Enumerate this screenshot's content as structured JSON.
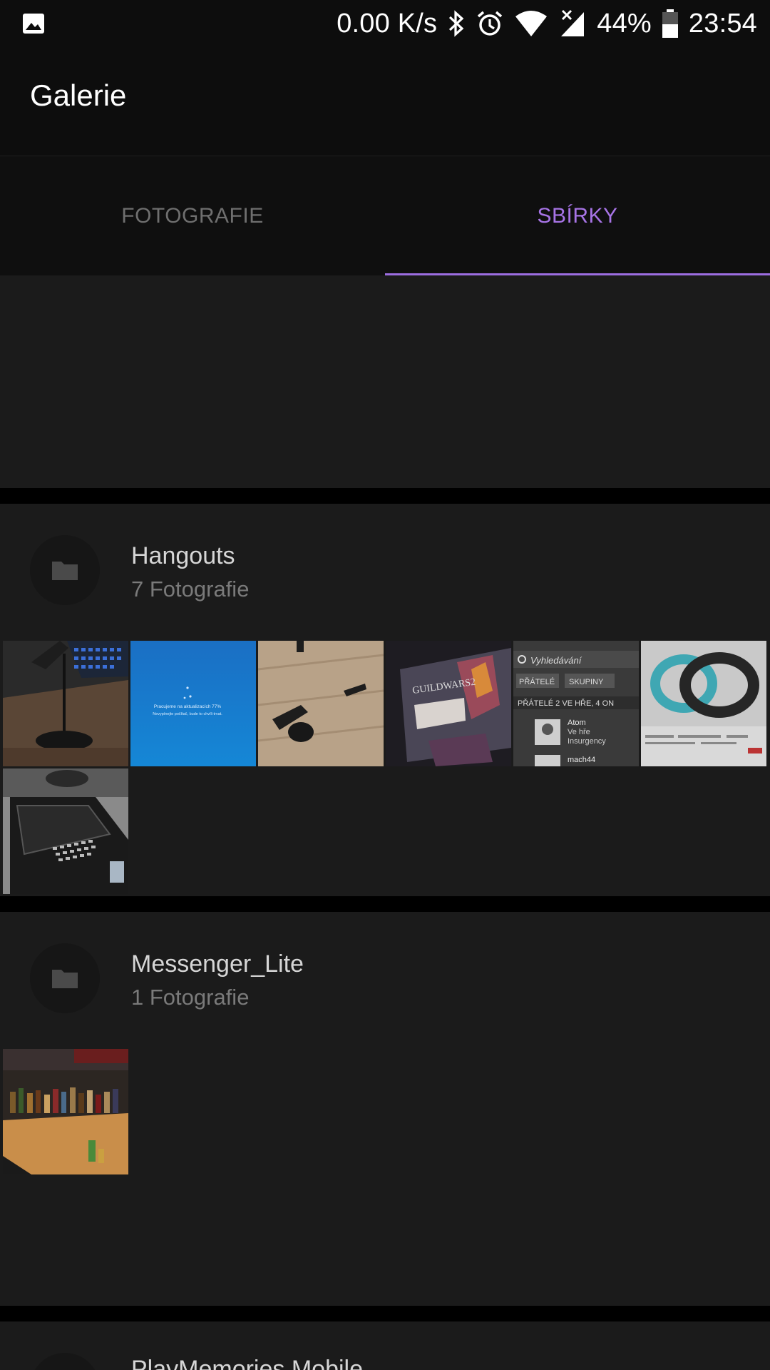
{
  "status_bar": {
    "net_speed": "0.00 K/s",
    "battery": "44%",
    "time": "23:54",
    "icons": [
      "gallery-notification-icon",
      "bluetooth-icon",
      "alarm-icon",
      "wifi-icon",
      "signal-icon",
      "battery-icon"
    ]
  },
  "app_bar": {
    "title": "Galerie"
  },
  "tabs": [
    {
      "label": "FOTOGRAFIE",
      "selected": false
    },
    {
      "label": "SBÍRKY",
      "selected": true
    }
  ],
  "colors": {
    "accent": "#a774e6",
    "background": "#1b1b1b",
    "separator": "#000000"
  },
  "albums": [
    {
      "name": "Hangouts",
      "count": "7 Fotografie",
      "icon": "folder-icon",
      "thumbnails": [
        "desk-lamp-photo",
        "windows-update-screen-photo",
        "chair-base-photo",
        "guild-wars-2-photo",
        "steam-friends-list-photo",
        "fitness-band-photo",
        "blackberry-phone-photo"
      ]
    },
    {
      "name": "Messenger_Lite",
      "count": "1 Fotografie",
      "icon": "folder-icon",
      "thumbnails": [
        "bottle-shelf-photo"
      ]
    },
    {
      "name": "PlayMemories Mobile",
      "icon": "folder-icon"
    }
  ],
  "thumbnail_text": {
    "windows_update": "Pracujeme na aktualizacích 77%",
    "windows_update_sub": "Nevypínejte počítač, bude to chvíli trvat.",
    "guild_wars": "GUILDWARS2",
    "steam_search": "Vyhledávání",
    "steam_friends_tab": "PŘÁTELÉ",
    "steam_groups_tab": "SKUPINY",
    "steam_section": "PŘÁTELÉ  2 VE HŘE, 4 ON",
    "steam_friend_name": "Atom",
    "steam_friend_status_1": "Ve hře",
    "steam_friend_status_2": "Insurgency",
    "steam_friend_2": "mach44"
  }
}
